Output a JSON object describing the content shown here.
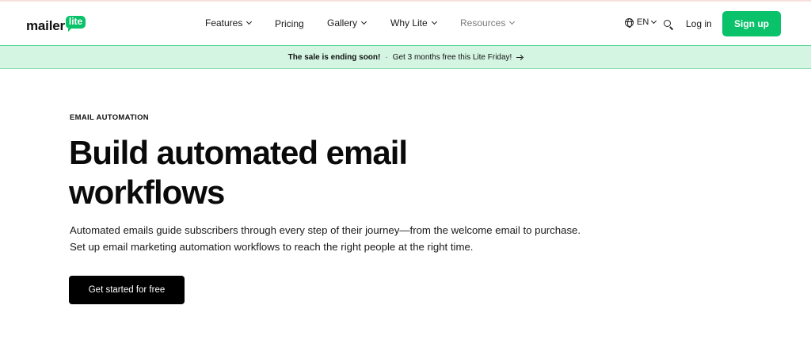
{
  "brand": {
    "wordmark": "mailer",
    "badge": "lite"
  },
  "nav": {
    "items": [
      {
        "label": "Features",
        "has_dropdown": true
      },
      {
        "label": "Pricing",
        "has_dropdown": false
      },
      {
        "label": "Gallery",
        "has_dropdown": true
      },
      {
        "label": "Why Lite",
        "has_dropdown": true
      },
      {
        "label": "Resources",
        "has_dropdown": true
      }
    ],
    "language": "EN",
    "login_label": "Log in",
    "signup_label": "Sign up"
  },
  "banner": {
    "strong_text": "The sale is ending soon!",
    "separator": "·",
    "text": "Get 3 months free this Lite Friday!"
  },
  "hero": {
    "eyebrow": "EMAIL AUTOMATION",
    "headline_line1": "Build automated email",
    "headline_line2": "workflows",
    "description": "Automated emails guide subscribers through every step of their journey—from the welcome email to purchase. Set up email marketing automation workflows to reach the right people at the right time.",
    "cta_label": "Get started for free"
  },
  "colors": {
    "brand_green": "#09c269",
    "banner_bg": "#d5f5e3",
    "cta_bg": "#000000"
  }
}
